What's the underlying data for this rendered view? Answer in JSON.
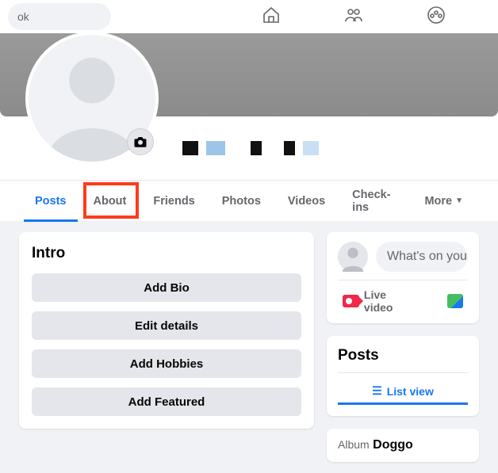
{
  "search": {
    "placeholder_fragment": "ok"
  },
  "tabs": {
    "posts": "Posts",
    "about": "About",
    "friends": "Friends",
    "photos": "Photos",
    "videos": "Videos",
    "checkins": "Check-ins",
    "more": "More"
  },
  "intro": {
    "title": "Intro",
    "add_bio": "Add Bio",
    "edit_details": "Edit details",
    "add_hobbies": "Add Hobbies",
    "add_featured": "Add Featured"
  },
  "composer": {
    "placeholder": "What's on your min",
    "live_video": "Live video"
  },
  "posts_section": {
    "title": "Posts",
    "list_view": "List view"
  },
  "album": {
    "label": "Album",
    "name": "Doggo"
  }
}
